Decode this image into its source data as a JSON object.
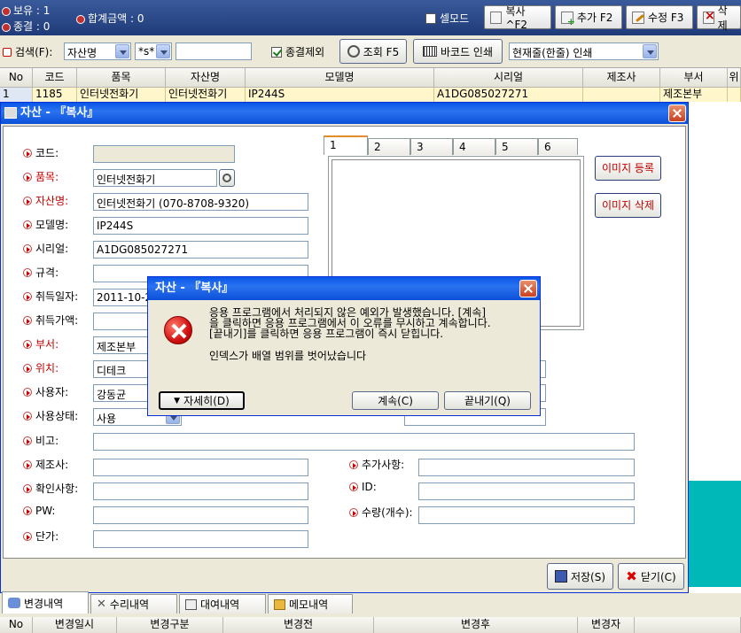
{
  "topbar": {
    "count_label": "보유 : 1",
    "closed_label": "종결 : 0",
    "total_label": "합계금액 : 0",
    "cellmode_label": "셀모드",
    "buttons": {
      "copy": "복사^F2",
      "add": "추가 F2",
      "edit": "수정 F3",
      "delete": "삭제"
    }
  },
  "search": {
    "label": "검색(F):",
    "field_select": "자산명",
    "match_select": "*s*",
    "input_value": "",
    "exclude_closed_label": "종결제외",
    "lookup_button": "조회 F5",
    "barcode_button": "바코드 인쇄",
    "print_mode_select": "현재줄(한줄) 인쇄"
  },
  "grid": {
    "columns": [
      "No",
      "코드",
      "품목",
      "자산명",
      "모델명",
      "시리얼",
      "제조사",
      "부서",
      "위"
    ],
    "rows": [
      [
        "1",
        "1185",
        "인터넷전화기",
        "인터넷전화기",
        "IP244S",
        "A1DG085027271",
        "",
        "제조본부",
        ""
      ]
    ]
  },
  "dialog": {
    "title": "자산 - 『복사』",
    "fields": {
      "code_label": "코드:",
      "code_value": "",
      "item_label": "품목:",
      "item_value": "인터넷전화기",
      "asset_label": "자산명:",
      "asset_value": "인터넷전화기 (070-8708-9320)",
      "model_label": "모델명:",
      "model_value": "IP244S",
      "serial_label": "시리얼:",
      "serial_value": "A1DG085027271",
      "spec_label": "규격:",
      "spec_value": "",
      "acq_date_label": "취득일자:",
      "acq_date_value": "2011-10-27",
      "acq_price_label": "취득가액:",
      "acq_price_value": "",
      "dept_label": "부서:",
      "dept_value": "제조본부",
      "location_label": "위치:",
      "location_value": "디테크",
      "user_label": "사용자:",
      "user_value": "강동균",
      "status_label": "사용상태:",
      "status_value": "사용",
      "note_label": "비고:",
      "note_value": "",
      "maker_label": "제조사:",
      "maker_value": "",
      "confirm_label": "확인사항:",
      "confirm_value": "",
      "pw_label": "PW:",
      "pw_value": "",
      "unit_price_label": "단가:",
      "unit_price_value": "",
      "extra_label": "추가사항:",
      "extra_value": "",
      "id_label": "ID:",
      "id_value": "",
      "qty_label": "수량(개수):",
      "qty_value": ""
    },
    "image_tabs": [
      "1",
      "2",
      "3",
      "4",
      "5",
      "6"
    ],
    "image_register_button": "이미지 등록",
    "image_delete_button": "이미지 삭제",
    "save_button": "저장(S)",
    "close_button": "닫기(C)"
  },
  "error": {
    "title": "자산 - 『복사』",
    "message_line1": "응용 프로그램에서 처리되지 않은 예외가 발생했습니다. [계속]",
    "message_line2": "을 클릭하면 응용 프로그램에서 이 오류를 무시하고 계속합니다.",
    "message_line3": "[끝내기]를 클릭하면 응용 프로그램이 즉시 닫힙니다.",
    "detail_message": "인덱스가 배열 범위를 벗어났습니다",
    "details_button": "자세히(D)",
    "continue_button": "계속(C)",
    "quit_button": "끝내기(Q)"
  },
  "bottom": {
    "tabs": [
      "변경내역",
      "수리내역",
      "대여내역",
      "메모내역"
    ],
    "columns": [
      "No",
      "변경일시",
      "변경구분",
      "변경전",
      "변경후",
      "변경자"
    ]
  }
}
